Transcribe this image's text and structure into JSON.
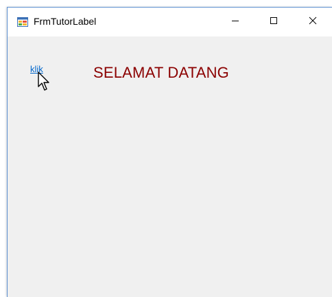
{
  "window": {
    "title": "FrmTutorLabel",
    "controls": {
      "minimize": "minimize",
      "maximize": "maximize",
      "close": "close"
    }
  },
  "form": {
    "link_label": "klik",
    "welcome_label": "SELAMAT DATANG"
  },
  "colors": {
    "link": "#0066cc",
    "welcome": "#8b0000",
    "form_bg": "#f0f0f0",
    "titlebar_bg": "#ffffff"
  },
  "icons": {
    "app": "form-app-icon",
    "cursor": "mouse-pointer-icon"
  }
}
